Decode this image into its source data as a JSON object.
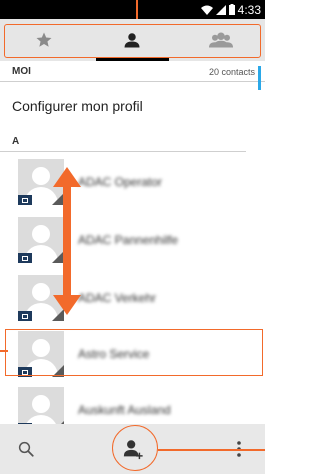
{
  "status_bar": {
    "time": "4:33",
    "icons": [
      "wifi-icon",
      "signal-icon",
      "battery-icon"
    ]
  },
  "tabs": [
    {
      "name": "favorites",
      "icon": "star-icon",
      "active": false
    },
    {
      "name": "contacts",
      "icon": "person-icon",
      "active": true
    },
    {
      "name": "groups",
      "icon": "group-icon",
      "active": false
    }
  ],
  "sections": {
    "moi": {
      "title": "MOI",
      "count": "20 contacts"
    },
    "a": {
      "title": "A"
    }
  },
  "profile": {
    "label": "Configurer mon profil"
  },
  "contacts": [
    {
      "name": "ADAC Operator"
    },
    {
      "name": "ADAC Pannenhilfe"
    },
    {
      "name": "ADAC Verkehr"
    },
    {
      "name": "Astro Service"
    },
    {
      "name": "Auskunft Ausland"
    }
  ],
  "bottom_bar": {
    "search_icon": "search-icon",
    "add_icon": "add-contact-icon",
    "menu_icon": "overflow-menu-icon"
  },
  "colors": {
    "annotation": "#f26a2b",
    "accent": "#2aa8e8",
    "avatar_bg": "#dcdcdc",
    "tab_bg": "#e6e6e6"
  }
}
